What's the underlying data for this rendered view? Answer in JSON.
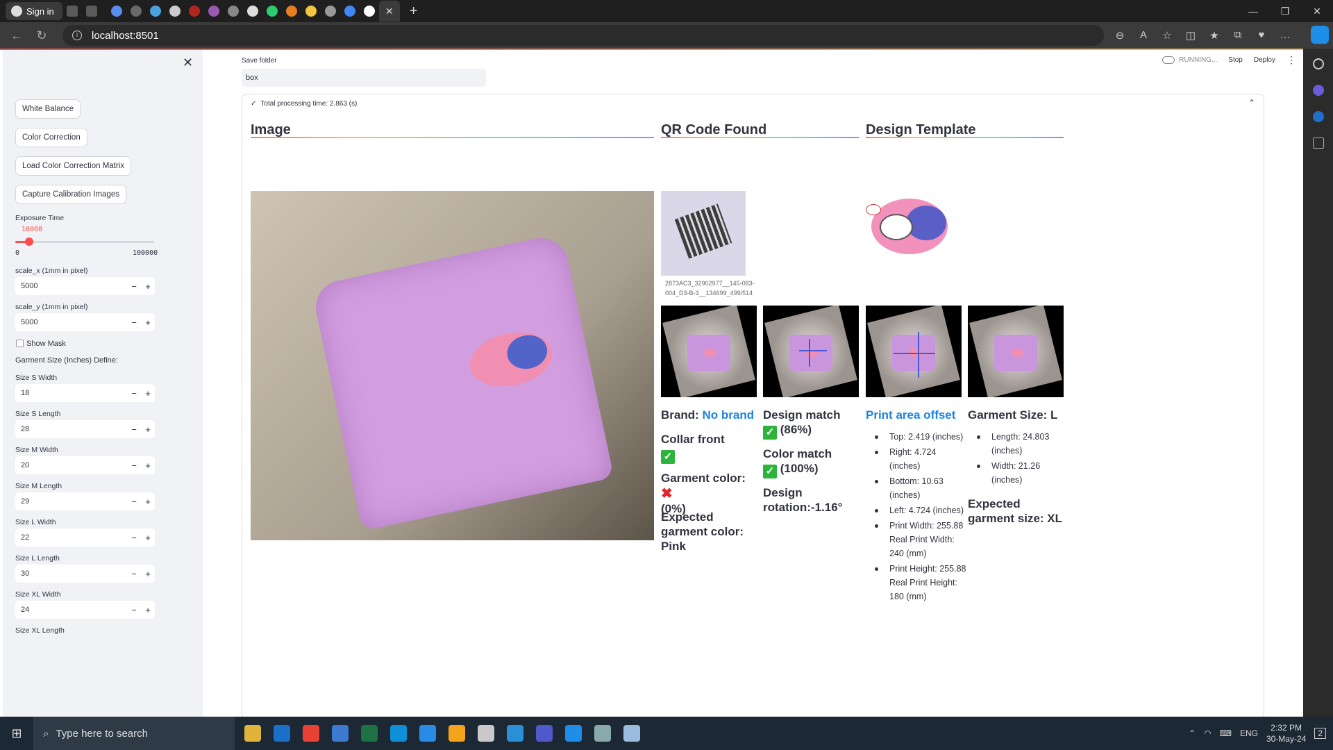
{
  "browser": {
    "signin": "Sign in",
    "url": "localhost:8501",
    "tabstrip_colors": [
      "#5b8def",
      "#6a6a6a",
      "#4aa3df",
      "#cccccc",
      "#b3261e",
      "#9b59b6",
      "#888888",
      "#dddddd",
      "#2ecc71",
      "#e67e22",
      "#f5c542",
      "#999999",
      "#4285f4",
      "#ffffff"
    ]
  },
  "sidebar": {
    "buttons": [
      "White Balance",
      "Color Correction",
      "Load Color Correction Matrix",
      "Capture Calibration Images"
    ],
    "exposure": {
      "label": "Exposure Time",
      "value": "10000",
      "min": "0",
      "max": "100000",
      "fraction": 0.1
    },
    "scale_x": {
      "label": "scale_x (1mm in pixel)",
      "value": "5000"
    },
    "scale_y": {
      "label": "scale_y (1mm in pixel)",
      "value": "5000"
    },
    "show_mask": "Show Mask",
    "size_header": "Garment Size (Inches) Define:",
    "sizes": [
      {
        "label": "Size S Width",
        "value": "18"
      },
      {
        "label": "Size S Length",
        "value": "28"
      },
      {
        "label": "Size M Width",
        "value": "20"
      },
      {
        "label": "Size M Length",
        "value": "29"
      },
      {
        "label": "Size L Width",
        "value": "22"
      },
      {
        "label": "Size L Length",
        "value": "30"
      },
      {
        "label": "Size XL Width",
        "value": "24"
      },
      {
        "label": "Size XL Length",
        "value": ""
      }
    ]
  },
  "header": {
    "running": "RUNNING...",
    "stop": "Stop",
    "deploy": "Deploy"
  },
  "main": {
    "save_label": "Save folder",
    "save_value": "box",
    "processing": "Total processing time: 2.863 (s)",
    "image_title": "Image",
    "qr_title": "QR Code Found",
    "qr_caption1": "2873AC3_32902977__145-083-",
    "qr_caption2": "004_D3-B-3__134699_499/514",
    "template_title": "Design Template",
    "brand_label": "Brand:",
    "brand_value": "No brand",
    "collar": "Collar front",
    "garment_color": "Garment color:",
    "garment_color_pct": "(0%)",
    "expected_color": "Expected garment color: Pink",
    "design_match": "Design match",
    "design_match_pct": "(86%)",
    "color_match": "Color match",
    "color_match_pct": "(100%)",
    "design_rotation": "Design rotation:-1.16°",
    "print_area_title": "Print area offset",
    "print_area": [
      "Top: 2.419 (inches)",
      "Right: 4.724 (inches)",
      "Bottom: 10.63 (inches)",
      "Left: 4.724 (inches)",
      "Print Width: 255.88 Real Print Width: 240 (mm)",
      "Print Height: 255.88 Real Print Height: 180 (mm)"
    ],
    "garment_size": "Garment Size: L",
    "size_list": [
      "Length: 24.803 (inches)",
      "Width: 21.26 (inches)"
    ],
    "expected_size": "Expected garment size: XL"
  },
  "taskbar": {
    "search": "Type here to search",
    "lang": "ENG",
    "time": "2:32 PM",
    "date": "30-May-24",
    "notif": "2",
    "app_colors": [
      "#e0b43c",
      "#1b6fc9",
      "#e94235",
      "#3d7bd1",
      "#1f7245",
      "#0f8fd6",
      "#2a8be6",
      "#f4a31b",
      "#c9c9c9",
      "#2b8fd6",
      "#5059c9",
      "#1f8ee8",
      "#8aa",
      "#9bd"
    ]
  }
}
